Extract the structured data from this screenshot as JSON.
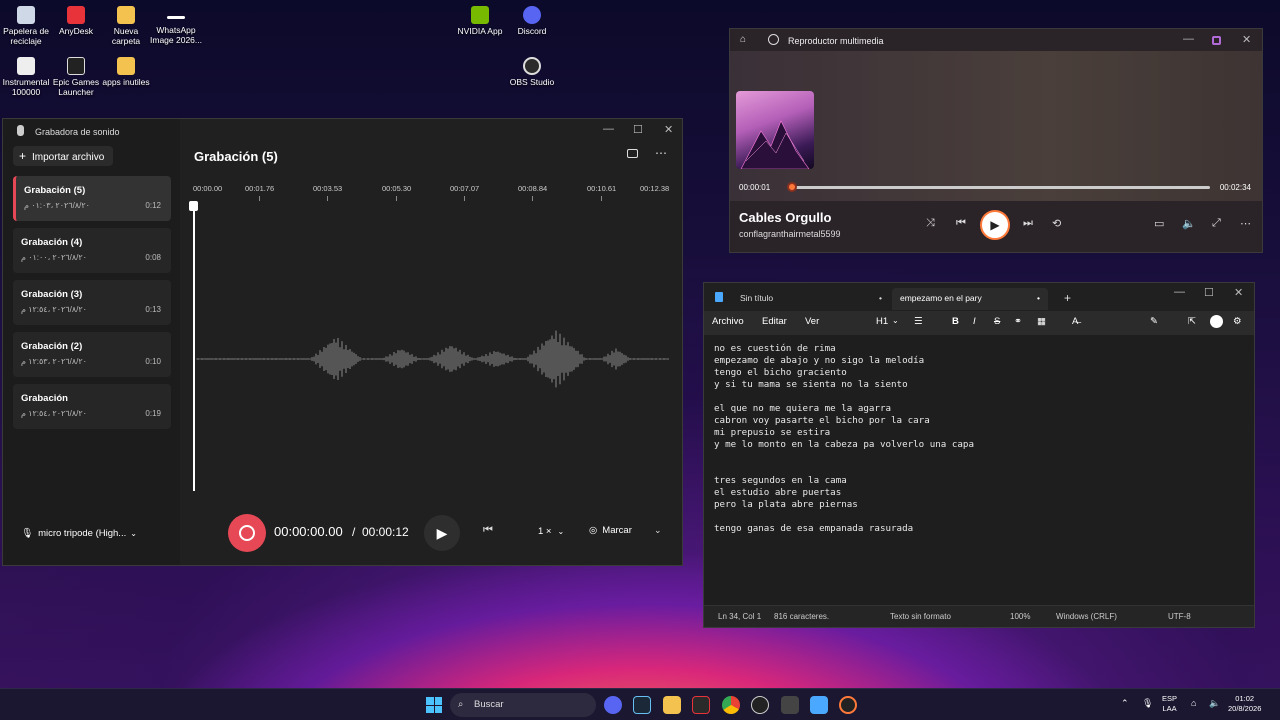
{
  "desktop": {
    "icons": [
      {
        "label": "Papelera de reciclaje"
      },
      {
        "label": "AnyDesk"
      },
      {
        "label": "Nueva carpeta"
      },
      {
        "label": "WhatsApp Image 2026..."
      },
      {
        "label": "NVIDIA App"
      },
      {
        "label": "Discord"
      },
      {
        "label": "Instrumental 100000"
      },
      {
        "label": "Epic Games Launcher"
      },
      {
        "label": "apps inutiles"
      },
      {
        "label": "OBS Studio"
      }
    ]
  },
  "recorder": {
    "app_title": "Grabadora de sonido",
    "import_label": "Importar archivo",
    "main_title": "Grabación (5)",
    "recordings": [
      {
        "name": "Grabación (5)",
        "date": "٢٠٢٦/٨/٢٠ ،٠١:٠٣ م",
        "duration": "0:12"
      },
      {
        "name": "Grabación (4)",
        "date": "٢٠٢٦/٨/٢٠ ،٠١:٠٠ م",
        "duration": "0:08"
      },
      {
        "name": "Grabación (3)",
        "date": "٢٠٢٦/٨/٢٠ ،١٢:٥٤ م",
        "duration": "0:13"
      },
      {
        "name": "Grabación (2)",
        "date": "٢٠٢٦/٨/٢٠ ،١٢:٥٣ م",
        "duration": "0:10"
      },
      {
        "name": "Grabación",
        "date": "٢٠٢٦/٨/٢٠ ،١٢:٥٤ م",
        "duration": "0:19"
      }
    ],
    "timeline_ticks": [
      "00:00.00",
      "00:01.76",
      "00:03.53",
      "00:05.30",
      "00:07.07",
      "00:08.84",
      "00:10.61",
      "00:12.38"
    ],
    "mic": "micro tripode (High...",
    "time_current": "00:00:00.00",
    "time_separator": "/",
    "time_total": "00:00:12",
    "speed": "1 ×",
    "mark_label": "Marcar"
  },
  "player": {
    "title": "Reproductor multimedia",
    "time_start": "00:00:01",
    "time_end": "00:02:34",
    "progress": 0.01,
    "song": "Cables Orgullo",
    "artist": "conflagranthairmetal5599"
  },
  "notepad": {
    "tabs": [
      "Sin título",
      "empezamo en el pary"
    ],
    "menu": [
      "Archivo",
      "Editar",
      "Ver"
    ],
    "heading_select": "H1",
    "lines": [
      "no es cuestión de rima",
      "empezamo de abajo y no sigo la melodía",
      "tengo el bicho graciento",
      "y si tu mama se sienta no la siento",
      "",
      "el que no me quiera me la agarra",
      "cabron voy pasarte el bicho por la cara",
      "mi prepusio se estira",
      "y me lo monto en la cabeza pa volverlo una capa",
      "",
      "",
      "tres segundos en la cama",
      "el estudio abre puertas",
      "pero la plata abre piernas",
      "",
      "tengo ganas de esa empanada rasurada"
    ],
    "status": {
      "position": "Ln 34, Col 1",
      "chars": "816 caracteres.",
      "format": "Texto sin formato",
      "zoom": "100%",
      "eol": "Windows (CRLF)",
      "encoding": "UTF-8"
    }
  },
  "taskbar": {
    "search": "Buscar",
    "lang": "ESP",
    "lang2": "LAA",
    "time": "01:02",
    "date": "20/8/2026"
  }
}
